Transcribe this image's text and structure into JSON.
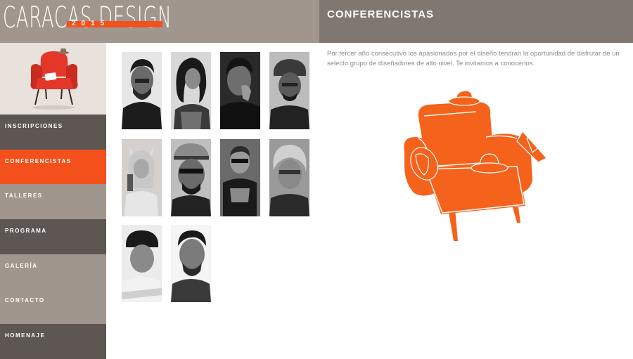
{
  "header": {
    "logo_text": "CARACAS DESIGN",
    "logo_year": "2015",
    "page_title": "CONFERENCISTAS"
  },
  "sidebar": {
    "items": [
      {
        "label": "INSCRIPCIONES",
        "state": "dark"
      },
      {
        "label": "CONFERENCISTAS",
        "state": "active"
      },
      {
        "label": "TALLERES",
        "state": "light"
      },
      {
        "label": "PROGRAMA",
        "state": "dark"
      },
      {
        "label": "GALERÍA",
        "state": "light"
      },
      {
        "label": "CONTACTO",
        "state": "light"
      },
      {
        "label": "HOMENAJE",
        "state": "dark"
      }
    ]
  },
  "main": {
    "description": "Por tercer año consecutivo los apasionados por el diseño tendrán la oportunidad de disfrutar de un selecto grupo de diseñadores de alto nivel. Te invitamos a conocerlos."
  },
  "colors": {
    "accent": "#f4501c",
    "nav_dark": "#5d5652",
    "nav_light": "#a1968d",
    "header_logo_bg": "#a1968d",
    "header_title_bg": "#807771"
  }
}
